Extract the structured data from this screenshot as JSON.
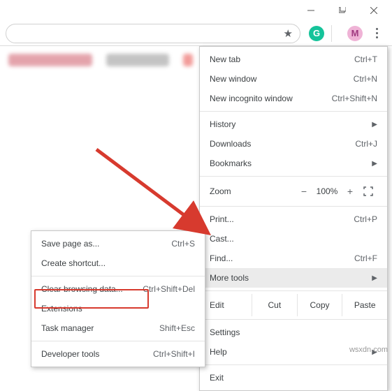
{
  "titlebar": {
    "minimize": "min",
    "maximize": "max",
    "close": "close"
  },
  "toolbar": {
    "star": "★",
    "grammarly_icon": "G",
    "profile_letter": "M"
  },
  "main_menu": {
    "new_tab": {
      "label": "New tab",
      "shortcut": "Ctrl+T"
    },
    "new_window": {
      "label": "New window",
      "shortcut": "Ctrl+N"
    },
    "incognito": {
      "label": "New incognito window",
      "shortcut": "Ctrl+Shift+N"
    },
    "history": {
      "label": "History"
    },
    "downloads": {
      "label": "Downloads",
      "shortcut": "Ctrl+J"
    },
    "bookmarks": {
      "label": "Bookmarks"
    },
    "zoom_label": "Zoom",
    "zoom_minus": "−",
    "zoom_pct": "100%",
    "zoom_plus": "+",
    "print": {
      "label": "Print...",
      "shortcut": "Ctrl+P"
    },
    "cast": {
      "label": "Cast..."
    },
    "find": {
      "label": "Find...",
      "shortcut": "Ctrl+F"
    },
    "more_tools": {
      "label": "More tools"
    },
    "edit_label": "Edit",
    "cut": "Cut",
    "copy": "Copy",
    "paste": "Paste",
    "settings": {
      "label": "Settings"
    },
    "help": {
      "label": "Help"
    },
    "exit": {
      "label": "Exit"
    }
  },
  "sub_menu": {
    "save_page": {
      "label": "Save page as...",
      "shortcut": "Ctrl+S"
    },
    "create_sc": {
      "label": "Create shortcut..."
    },
    "clear_data": {
      "label": "Clear browsing data...",
      "shortcut": "Ctrl+Shift+Del"
    },
    "extensions": {
      "label": "Extensions"
    },
    "task_mgr": {
      "label": "Task manager",
      "shortcut": "Shift+Esc"
    },
    "dev_tools": {
      "label": "Developer tools",
      "shortcut": "Ctrl+Shift+I"
    }
  },
  "watermark": "wsxdn.com"
}
